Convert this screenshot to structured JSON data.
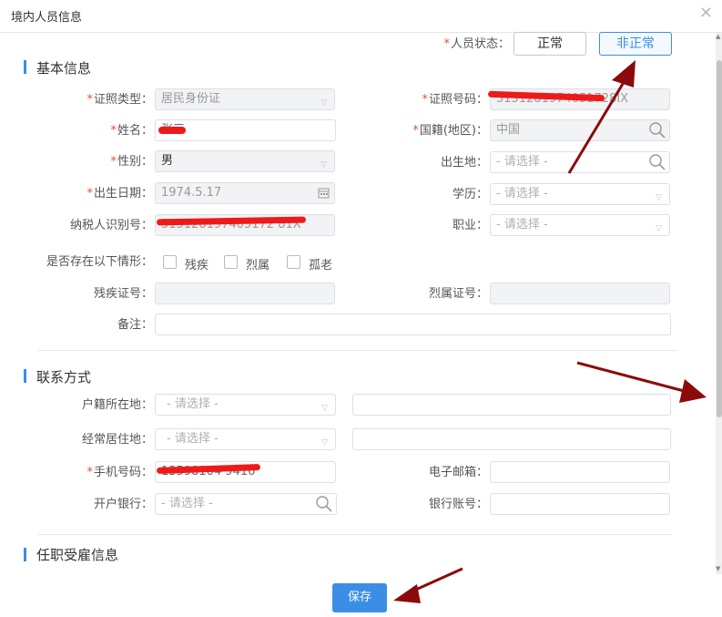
{
  "dialog": {
    "title": "境内人员信息"
  },
  "status": {
    "label": "人员状态：",
    "normal": "正常",
    "abnormal": "非正常"
  },
  "sections": {
    "basic": "基本信息",
    "contact": "联系方式",
    "employment": "任职受雇信息"
  },
  "basic": {
    "id_type_label": "证照类型：",
    "id_type_value": "居民身份证",
    "id_number_label": "证照号码：",
    "id_number_value": "5151281974051728IX",
    "name_label": "姓名：",
    "name_value": "张三",
    "nationality_label": "国籍(地区)：",
    "nationality_value": "中国",
    "gender_label": "性别：",
    "gender_value": "男",
    "birthplace_label": "出生地：",
    "birthplace_placeholder": "- 请选择 -",
    "birthdate_label": "出生日期：",
    "birthdate_value": "1974.5.17",
    "education_label": "学历：",
    "education_placeholder": "- 请选择 -",
    "taxpayer_id_label": "纳税人识别号：",
    "taxpayer_id_value": "515128197405172 81X",
    "occupation_label": "职业：",
    "occupation_placeholder": "- 请选择 -",
    "situation_label": "是否存在以下情形：",
    "situations": [
      "残疾",
      "烈属",
      "孤老"
    ],
    "disability_cert_label": "残疾证号：",
    "martyr_cert_label": "烈属证号：",
    "remark_label": "备注："
  },
  "contact": {
    "household_label": "户籍所在地：",
    "household_placeholder": "- 请选择 -",
    "residence_label": "经常居住地：",
    "residence_placeholder": "- 请选择 -",
    "mobile_label": "手机号码：",
    "mobile_value": "13598104 9416",
    "email_label": "电子邮箱：",
    "bank_label": "开户银行：",
    "bank_placeholder": "- 请选择 -",
    "account_label": "银行账号："
  },
  "actions": {
    "save": "保存"
  },
  "colors": {
    "accent": "#3a8ee6",
    "required": "#e8502c",
    "annotation": "#8b0a0a"
  }
}
